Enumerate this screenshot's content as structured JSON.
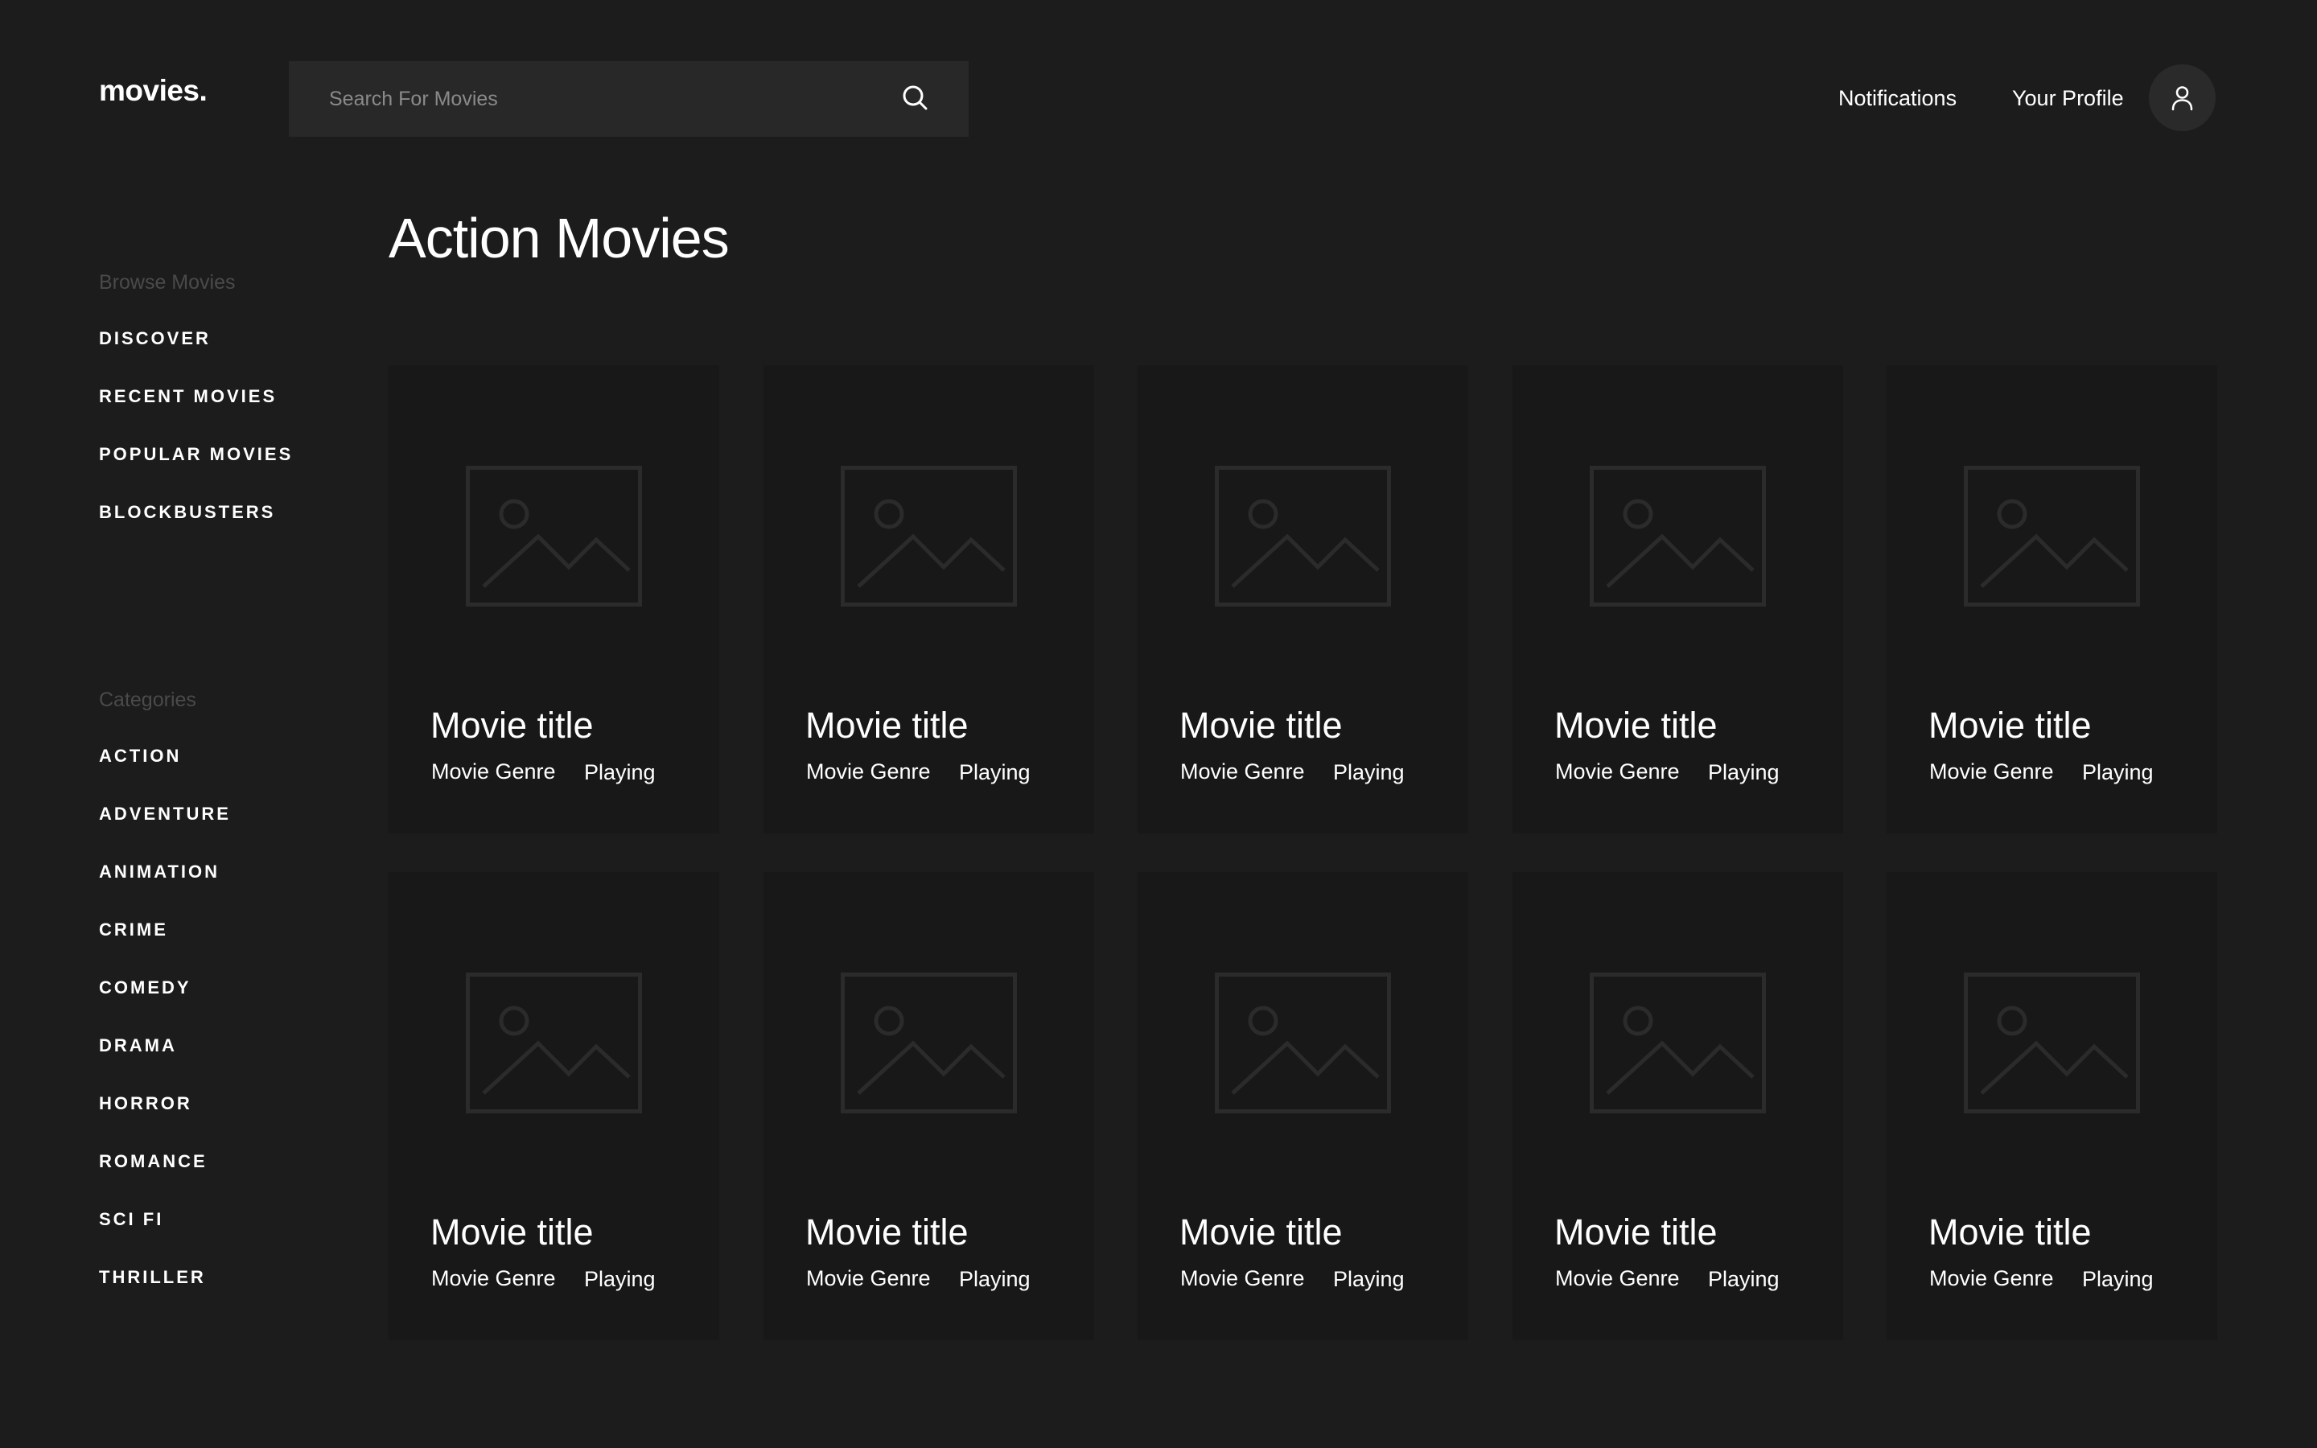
{
  "brand": {
    "logo": "movies."
  },
  "search": {
    "placeholder": "Search For Movies",
    "value": ""
  },
  "header": {
    "notifications": "Notifications",
    "profile": "Your Profile"
  },
  "sidebar": {
    "browse_label": "Browse Movies",
    "browse_items": [
      "DISCOVER",
      "RECENT MOVIES",
      "POPULAR MOVIES",
      "BLOCKBUSTERS"
    ],
    "categories_label": "Categories",
    "category_items": [
      "ACTION",
      "ADVENTURE",
      "ANIMATION",
      "CRIME",
      "COMEDY",
      "DRAMA",
      "HORROR",
      "ROMANCE",
      "SCI FI",
      "THRILLER"
    ]
  },
  "main": {
    "title": "Action Movies",
    "movies": [
      {
        "title": "Movie title",
        "genre": "Movie Genre",
        "status": "Playing"
      },
      {
        "title": "Movie title",
        "genre": "Movie Genre",
        "status": "Playing"
      },
      {
        "title": "Movie title",
        "genre": "Movie Genre",
        "status": "Playing"
      },
      {
        "title": "Movie title",
        "genre": "Movie Genre",
        "status": "Playing"
      },
      {
        "title": "Movie title",
        "genre": "Movie Genre",
        "status": "Playing"
      },
      {
        "title": "Movie title",
        "genre": "Movie Genre",
        "status": "Playing"
      },
      {
        "title": "Movie title",
        "genre": "Movie Genre",
        "status": "Playing"
      },
      {
        "title": "Movie title",
        "genre": "Movie Genre",
        "status": "Playing"
      },
      {
        "title": "Movie title",
        "genre": "Movie Genre",
        "status": "Playing"
      },
      {
        "title": "Movie title",
        "genre": "Movie Genre",
        "status": "Playing"
      }
    ]
  },
  "icons": {
    "search": "search-icon",
    "user": "user-icon",
    "placeholder": "image-placeholder-icon"
  },
  "colors": {
    "background": "#1c1c1c",
    "card": "#181818",
    "search_field": "#282828",
    "avatar": "#2a2a2a",
    "text": "#ffffff",
    "muted": "#4a4a4a",
    "placeholder_icon": "#2b2b2b"
  }
}
